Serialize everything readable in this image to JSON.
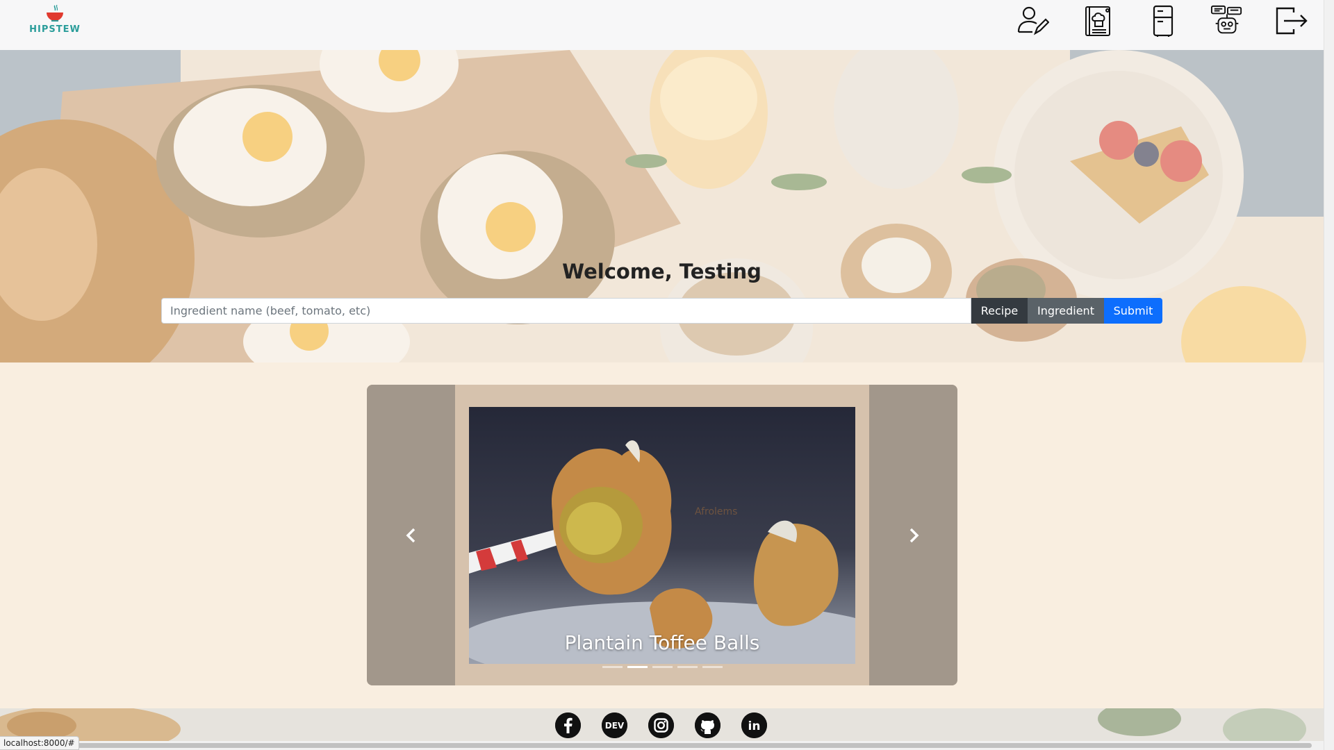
{
  "brand": {
    "name": "HIPSTEW"
  },
  "nav": {
    "items": [
      {
        "name": "edit-profile",
        "icon": "user-edit-icon"
      },
      {
        "name": "recipes",
        "icon": "recipe-book-icon"
      },
      {
        "name": "fridge",
        "icon": "fridge-icon"
      },
      {
        "name": "chat",
        "icon": "chat-robot-icon"
      },
      {
        "name": "logout",
        "icon": "logout-icon"
      }
    ]
  },
  "hero": {
    "welcome": "Welcome, Testing",
    "search_placeholder": "Ingredient name (beef, tomato, etc)",
    "btn_recipe": "Recipe",
    "btn_ingredient": "Ingredient",
    "btn_submit": "Submit"
  },
  "carousel": {
    "caption": "Plantain Toffee Balls",
    "watermark": "Afrolems",
    "indicator_count": 5,
    "active_index": 1
  },
  "footer": {
    "social": [
      {
        "name": "facebook",
        "icon": "facebook-icon"
      },
      {
        "name": "dev",
        "icon": "dev-icon",
        "label": "DEV"
      },
      {
        "name": "instagram",
        "icon": "instagram-icon"
      },
      {
        "name": "github",
        "icon": "github-icon"
      },
      {
        "name": "linkedin",
        "icon": "linkedin-icon",
        "label": "in"
      }
    ]
  },
  "status_bar": {
    "url": "localhost:8000/#"
  },
  "colors": {
    "brand_teal": "#2a9d9a",
    "brand_red": "#e03a2f",
    "page_bg": "#f9eee0",
    "submit_blue": "#0d6efd"
  }
}
